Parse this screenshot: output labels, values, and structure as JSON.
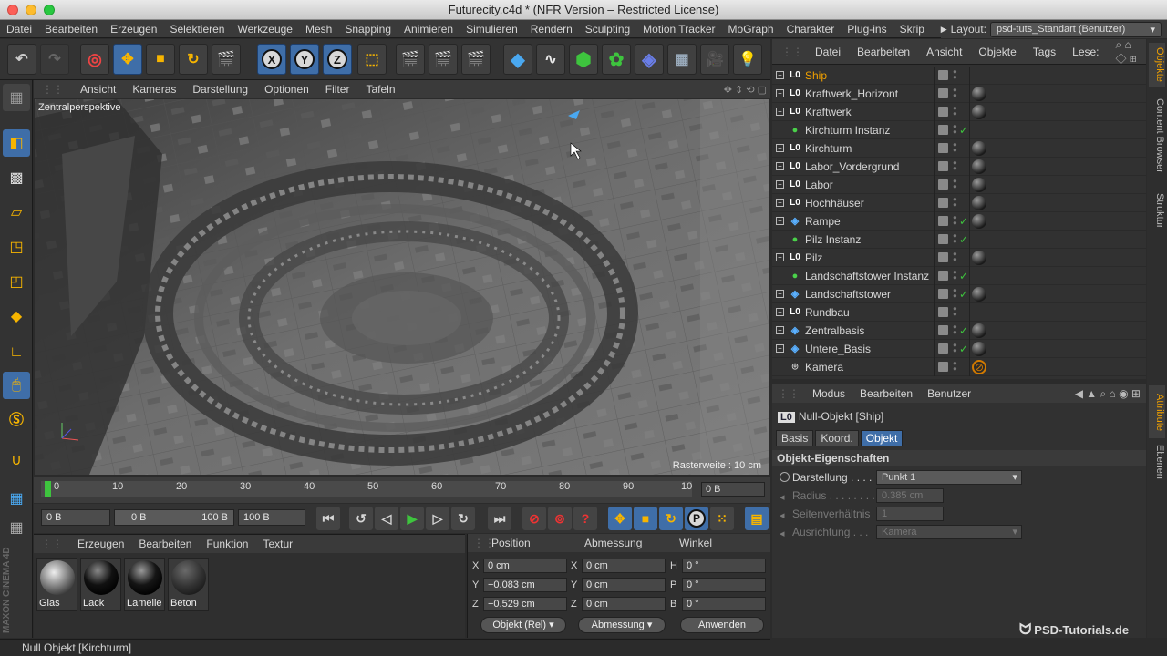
{
  "window": {
    "title": "Futurecity.c4d * (NFR Version – Restricted License)"
  },
  "menubar": {
    "items": [
      "Datei",
      "Bearbeiten",
      "Erzeugen",
      "Selektieren",
      "Werkzeuge",
      "Mesh",
      "Snapping",
      "Animieren",
      "Simulieren",
      "Rendern",
      "Sculpting",
      "Motion Tracker",
      "MoGraph",
      "Charakter",
      "Plug-ins",
      "Skrip"
    ],
    "layout_label": "Layout:",
    "layout_value": "psd-tuts_Standart (Benutzer)"
  },
  "toolbar": {
    "x_label": "X",
    "y_label": "Y",
    "z_label": "Z"
  },
  "viewport": {
    "menu": [
      "Ansicht",
      "Kameras",
      "Darstellung",
      "Optionen",
      "Filter",
      "Tafeln"
    ],
    "view_label": "Zentralperspektive",
    "grid_label": "Rasterweite : 10 cm"
  },
  "timeline": {
    "ticks": [
      "0",
      "10",
      "20",
      "30",
      "40",
      "50",
      "60",
      "70",
      "80",
      "90",
      "10"
    ],
    "current_frame": "0 B"
  },
  "playback": {
    "start": "0 B",
    "range_start": "0 B",
    "range_end": "100 B",
    "end": "100 B",
    "p_label": "P"
  },
  "materials": {
    "menu": [
      "Erzeugen",
      "Bearbeiten",
      "Funktion",
      "Textur"
    ],
    "items": [
      {
        "name": "Glas"
      },
      {
        "name": "Lack"
      },
      {
        "name": "Lamelle"
      },
      {
        "name": "Beton"
      }
    ]
  },
  "coordinates": {
    "headers": [
      "Position",
      "Abmessung",
      "Winkel"
    ],
    "rows": [
      {
        "axis": "X",
        "pos": "0 cm",
        "size_axis": "X",
        "size": "0 cm",
        "rot_axis": "H",
        "rot": "0 °"
      },
      {
        "axis": "Y",
        "pos": "−0.083 cm",
        "size_axis": "Y",
        "size": "0 cm",
        "rot_axis": "P",
        "rot": "0 °"
      },
      {
        "axis": "Z",
        "pos": "−0.529 cm",
        "size_axis": "Z",
        "size": "0 cm",
        "rot_axis": "B",
        "rot": "0 °"
      }
    ],
    "mode_dropdown": "Objekt (Rel)",
    "size_dropdown": "Abmessung",
    "apply_button": "Anwenden"
  },
  "status": {
    "text": "Null Objekt [Kirchturm]"
  },
  "logo": {
    "text": "MAXON CINEMA 4D"
  },
  "objects_panel": {
    "menu": [
      "Datei",
      "Bearbeiten",
      "Ansicht",
      "Objekte",
      "Tags",
      "Lese:"
    ],
    "items": [
      {
        "name": "Ship",
        "icon": "null-icon",
        "selected": true,
        "check": false,
        "tag": "none"
      },
      {
        "name": "Kraftwerk_Horizont",
        "icon": "null-icon",
        "check": false,
        "tag": "material"
      },
      {
        "name": "Kraftwerk",
        "icon": "null-icon",
        "check": false,
        "tag": "material"
      },
      {
        "name": "Kirchturm Instanz",
        "icon": "instance-icon",
        "check": true,
        "tag": "none"
      },
      {
        "name": "Kirchturm",
        "icon": "null-icon",
        "check": false,
        "tag": "material"
      },
      {
        "name": "Labor_Vordergrund",
        "icon": "null-icon",
        "check": false,
        "tag": "material"
      },
      {
        "name": "Labor",
        "icon": "null-icon",
        "check": false,
        "tag": "material"
      },
      {
        "name": "Hochhäuser",
        "icon": "null-icon",
        "check": false,
        "tag": "material"
      },
      {
        "name": "Rampe",
        "icon": "symmetry-icon",
        "check": true,
        "tag": "material"
      },
      {
        "name": "Pilz Instanz",
        "icon": "instance-icon",
        "check": true,
        "tag": "none"
      },
      {
        "name": "Pilz",
        "icon": "null-icon",
        "check": false,
        "tag": "material"
      },
      {
        "name": "Landschaftstower Instanz",
        "icon": "instance-icon",
        "check": true,
        "tag": "none"
      },
      {
        "name": "Landschaftstower",
        "icon": "symmetry-icon",
        "check": true,
        "tag": "material"
      },
      {
        "name": "Rundbau",
        "icon": "null-icon",
        "check": false,
        "tag": "none"
      },
      {
        "name": "Zentralbasis",
        "icon": "symmetry-icon",
        "check": true,
        "tag": "material"
      },
      {
        "name": "Untere_Basis",
        "icon": "symmetry-icon",
        "check": true,
        "tag": "material"
      },
      {
        "name": "Kamera",
        "icon": "camera-icon",
        "check": false,
        "tag": "protection"
      }
    ]
  },
  "side_tabs": {
    "top": [
      "Objekte",
      "Content Browser",
      "Struktur"
    ],
    "bottom": [
      "Attribute",
      "Ebenen"
    ]
  },
  "attributes_panel": {
    "menu": [
      "Modus",
      "Bearbeiten",
      "Benutzer"
    ],
    "title": "Null-Objekt [Ship]",
    "tabs": [
      "Basis",
      "Koord.",
      "Objekt"
    ],
    "section": "Objekt-Eigenschaften",
    "props": [
      {
        "label": "Darstellung . . . .",
        "value": "Punkt 1"
      },
      {
        "label": "Radius . . . . . . . .",
        "value": "0.385 cm"
      },
      {
        "label": "Seitenverhältnis",
        "value": "1"
      },
      {
        "label": "Ausrichtung . . .",
        "value": "Kamera"
      }
    ]
  },
  "watermark": {
    "text": "PSD-Tutorials.de"
  },
  "colors": {
    "accent": "#3f6ea8",
    "selected_text": "#f0a000",
    "check": "#3ec43e"
  }
}
